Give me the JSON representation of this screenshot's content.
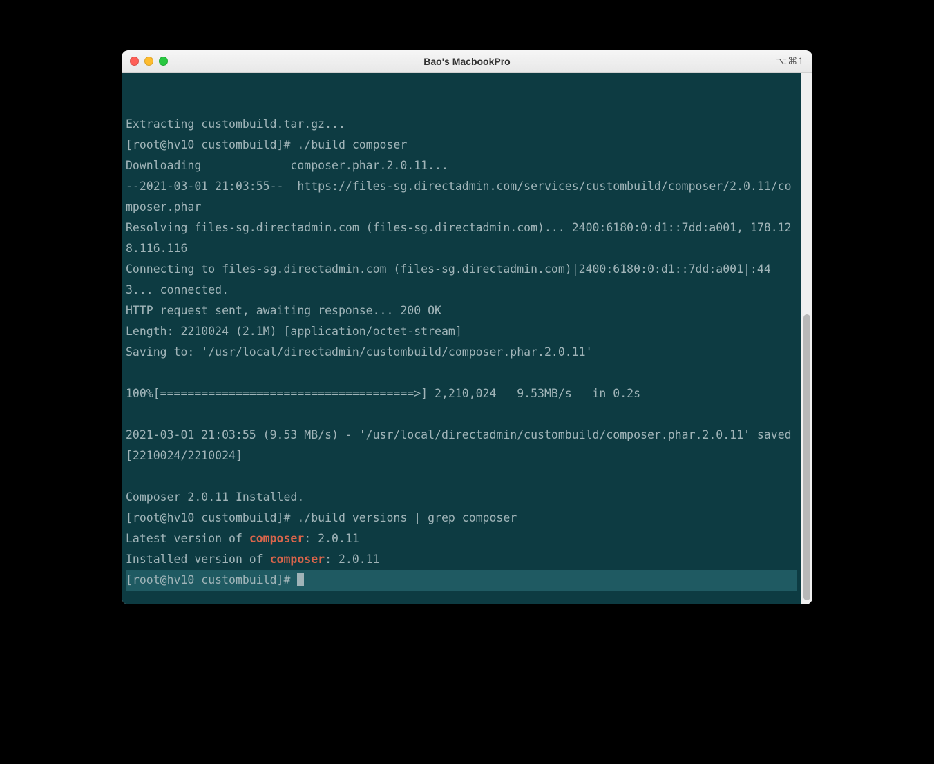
{
  "window": {
    "title": "Bao's MacbookPro",
    "shortcut": "⌥⌘1"
  },
  "terminal": {
    "lines": [
      {
        "t": "plain",
        "text": "Extracting custombuild.tar.gz..."
      },
      {
        "t": "plain",
        "text": "[root@hv10 custombuild]# ./build composer"
      },
      {
        "t": "plain",
        "text": "Downloading             composer.phar.2.0.11..."
      },
      {
        "t": "plain",
        "text": "--2021-03-01 21:03:55--  https://files-sg.directadmin.com/services/custombuild/composer/2.0.11/composer.phar"
      },
      {
        "t": "plain",
        "text": "Resolving files-sg.directadmin.com (files-sg.directadmin.com)... 2400:6180:0:d1::7dd:a001, 178.128.116.116"
      },
      {
        "t": "plain",
        "text": "Connecting to files-sg.directadmin.com (files-sg.directadmin.com)|2400:6180:0:d1::7dd:a001|:443... connected."
      },
      {
        "t": "plain",
        "text": "HTTP request sent, awaiting response... 200 OK"
      },
      {
        "t": "plain",
        "text": "Length: 2210024 (2.1M) [application/octet-stream]"
      },
      {
        "t": "plain",
        "text": "Saving to: '/usr/local/directadmin/custombuild/composer.phar.2.0.11'"
      },
      {
        "t": "plain",
        "text": ""
      },
      {
        "t": "plain",
        "text": "100%[=====================================>] 2,210,024   9.53MB/s   in 0.2s"
      },
      {
        "t": "plain",
        "text": ""
      },
      {
        "t": "plain",
        "text": "2021-03-01 21:03:55 (9.53 MB/s) - '/usr/local/directadmin/custombuild/composer.phar.2.0.11' saved [2210024/2210024]"
      },
      {
        "t": "plain",
        "text": ""
      },
      {
        "t": "plain",
        "text": "Composer 2.0.11 Installed."
      },
      {
        "t": "plain",
        "text": "[root@hv10 custombuild]# ./build versions | grep composer"
      },
      {
        "t": "hl",
        "pre": "Latest version of ",
        "hl": "composer",
        "post": ": 2.0.11"
      },
      {
        "t": "hl",
        "pre": "Installed version of ",
        "hl": "composer",
        "post": ": 2.0.11"
      },
      {
        "t": "cursor",
        "text": "[root@hv10 custombuild]# "
      }
    ]
  }
}
